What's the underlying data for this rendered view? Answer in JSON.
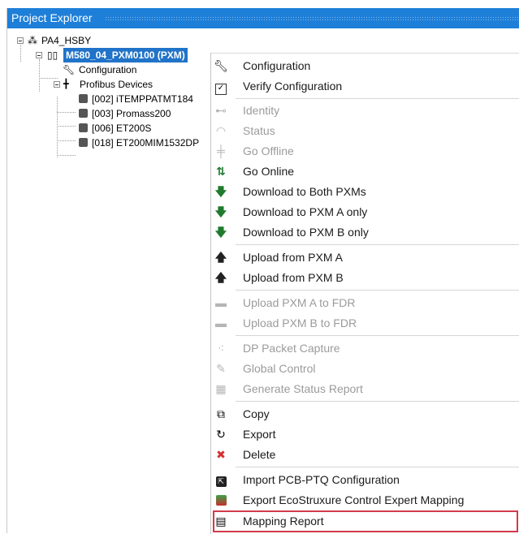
{
  "panel": {
    "title": "Project Explorer"
  },
  "tree": {
    "root": "PA4_HSBY",
    "controller": "M580_04_PXM0100 (PXM)",
    "configuration": "Configuration",
    "profibus": "Profibus Devices",
    "devices": [
      "[002] iTEMPPATMT184",
      "[003] Promass200",
      "[006] ET200S",
      "[018] ET200MIM1532DP"
    ]
  },
  "menu": {
    "items": [
      {
        "label": "Configuration",
        "icon": "wrench-icon"
      },
      {
        "label": "Verify Configuration",
        "icon": "checkbox-icon"
      },
      {
        "label": "Identity",
        "icon": "identity-icon"
      },
      {
        "label": "Status",
        "icon": "status-icon"
      },
      {
        "label": "Go Offline",
        "icon": "go-offline-icon"
      },
      {
        "label": "Go Online",
        "icon": "go-online-icon"
      },
      {
        "label": "Download to Both PXMs",
        "icon": "download-arrow-icon"
      },
      {
        "label": "Download to PXM A only",
        "icon": "download-arrow-icon"
      },
      {
        "label": "Download to PXM B only",
        "icon": "download-arrow-icon"
      },
      {
        "label": "Upload from PXM A",
        "icon": "upload-arrow-icon"
      },
      {
        "label": "Upload from PXM B",
        "icon": "upload-arrow-icon"
      },
      {
        "label": "Upload PXM A to FDR",
        "icon": "fdr-icon"
      },
      {
        "label": "Upload PXM B to FDR",
        "icon": "fdr-icon"
      },
      {
        "label": "DP Packet Capture",
        "icon": "packet-capture-icon"
      },
      {
        "label": "Global Control",
        "icon": "global-control-icon"
      },
      {
        "label": "Generate Status Report",
        "icon": "report-icon"
      },
      {
        "label": "Copy",
        "icon": "copy-icon"
      },
      {
        "label": "Export",
        "icon": "export-icon"
      },
      {
        "label": "Delete",
        "icon": "delete-icon"
      },
      {
        "label": "Import PCB-PTQ Configuration",
        "icon": "import-icon"
      },
      {
        "label": "Export EcoStruxure Control Expert Mapping",
        "icon": "export-mapping-icon"
      },
      {
        "label": "Mapping Report",
        "icon": "mapping-report-icon"
      }
    ]
  },
  "colors": {
    "titlebar": "#1e7fd8",
    "selection": "#2173c8",
    "highlight_border": "#d33a4b",
    "green_arrow": "#1f7a2e",
    "disabled_text": "#9b9b9b"
  }
}
